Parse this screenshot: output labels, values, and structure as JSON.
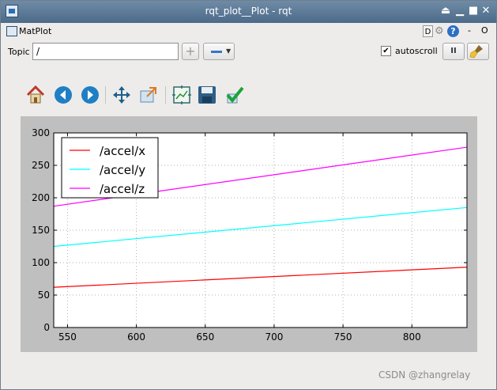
{
  "window": {
    "title": "rqt_plot__Plot - rqt"
  },
  "plugin": {
    "name": "MatPlot",
    "d_label": "D",
    "help_label": "?",
    "minus_label": "-",
    "zero_label": "O"
  },
  "topic": {
    "label": "Topic",
    "value": "/",
    "add_label": "+"
  },
  "autoscroll": {
    "label": "autoscroll",
    "checked_mark": "✔"
  },
  "pause": {
    "label": "II"
  },
  "watermark": "CSDN @zhangrelay",
  "toolbar_icons": [
    "home-icon",
    "back-icon",
    "forward-icon",
    "pan-icon",
    "zoom-icon",
    "subplots-icon",
    "save-icon",
    "apply-icon"
  ],
  "chart_data": {
    "type": "line",
    "x": [
      540,
      840
    ],
    "xlim": [
      540,
      840
    ],
    "ylim": [
      0,
      300
    ],
    "xticks": [
      550,
      600,
      650,
      700,
      750,
      800
    ],
    "yticks": [
      0,
      50,
      100,
      150,
      200,
      250,
      300
    ],
    "grid": true,
    "legend_position": "top-left",
    "series": [
      {
        "name": "/accel/x",
        "color": "#ff0000",
        "values": [
          62,
          93
        ]
      },
      {
        "name": "/accel/y",
        "color": "#00ffff",
        "values": [
          125,
          185
        ]
      },
      {
        "name": "/accel/z",
        "color": "#ff00ff",
        "values": [
          187,
          278
        ]
      }
    ]
  }
}
